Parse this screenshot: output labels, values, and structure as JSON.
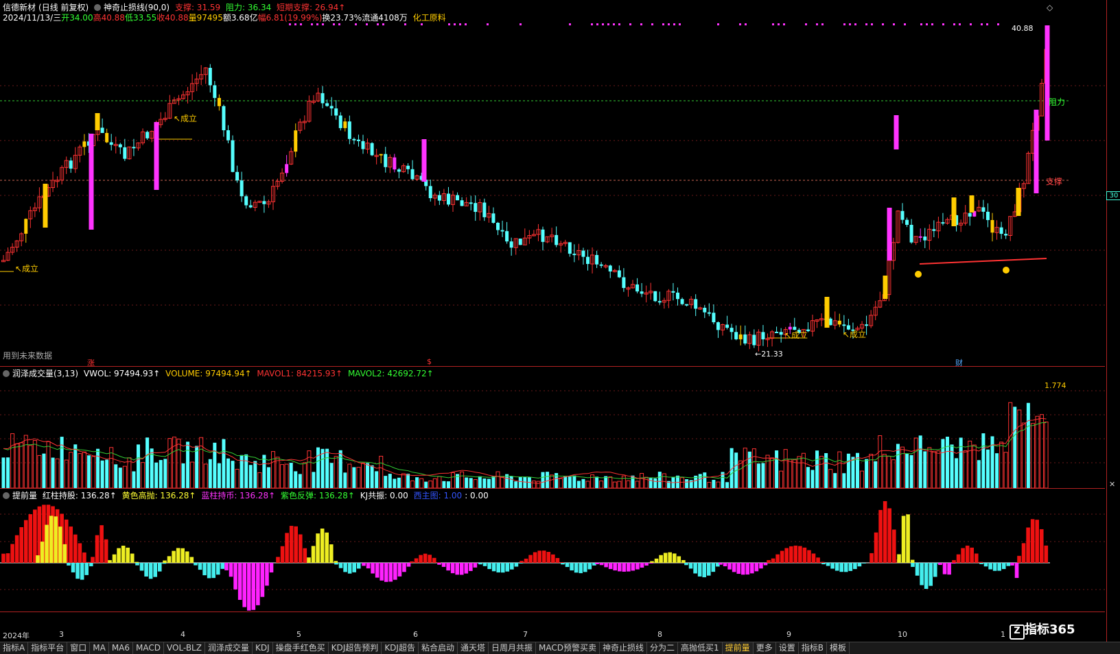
{
  "header": {
    "stock_name": "信德新材",
    "mode": "(日线 前复权)",
    "indicator_name": "神奇止损线(90,0)",
    "support_label": "支撑: 31.59",
    "resistance_label": "阻力: 36.34",
    "short_support_label": "短期支撑: 26.94↑"
  },
  "quote": {
    "date": "2024/11/13/三",
    "open": "开34.00",
    "high": "高40.88",
    "low": "低33.55",
    "close": "收40.88",
    "volume": "量97495",
    "amount": "额3.68亿",
    "change": "幅6.81(19.99%)",
    "turnover": "换23.73%",
    "float": "流通4108万",
    "sector": "化工原料"
  },
  "price_pane": {
    "max_label": "40.88",
    "min_label": "←21.33",
    "resistance_tag": "阻力",
    "support_tag": "支撑",
    "future_data_note": "用到未来数据",
    "chengli": "↖成立",
    "event_tags": [
      "涨",
      "$",
      "财"
    ],
    "right_scale": "30"
  },
  "volume_pane": {
    "title": "润泽成交量(3,13)",
    "vwol": "VWOL: 97494.93↑",
    "volume": "VOLUME: 97494.94↑",
    "mavol1": "MAVOL1: 84215.93↑",
    "mavol2": "MAVOL2: 42692.72↑",
    "scale_top": "1.774"
  },
  "ind_pane": {
    "title": "提前量",
    "red": "红柱持股: 136.28↑",
    "yellow": "黄色高抛: 136.28↑",
    "blue": "蓝柱持币: 136.28↑",
    "purple": "紫色反弹: 136.28↑",
    "kj": "KJ共振: 0.00",
    "west": "西主图: 1.00",
    "zero": ": 0.00"
  },
  "date_axis": [
    "2024年",
    "3",
    "4",
    "5",
    "6",
    "7",
    "8",
    "9",
    "10",
    "1"
  ],
  "tabs": [
    "指标A",
    "指标平台",
    "窗口",
    "MA",
    "MA6",
    "MACD",
    "VOL-BLZ",
    "润泽成交量",
    "KDJ",
    "操盘手红色买",
    "KDJ超告预判",
    "KDJ超告",
    "粘合启动",
    "通天塔",
    "日周月共振",
    "MACD预警买卖",
    "神奇止损线",
    "分为二",
    "高抛低买1",
    "提前量",
    "更多",
    "设置",
    "指标B",
    "模板"
  ],
  "active_tab": "提前量",
  "brand": "指标365",
  "colors": {
    "up": "#ff3333",
    "down": "#55ffff",
    "magenta": "#ff33ff",
    "yellow": "#ffcc00",
    "green": "#33cc33"
  }
}
